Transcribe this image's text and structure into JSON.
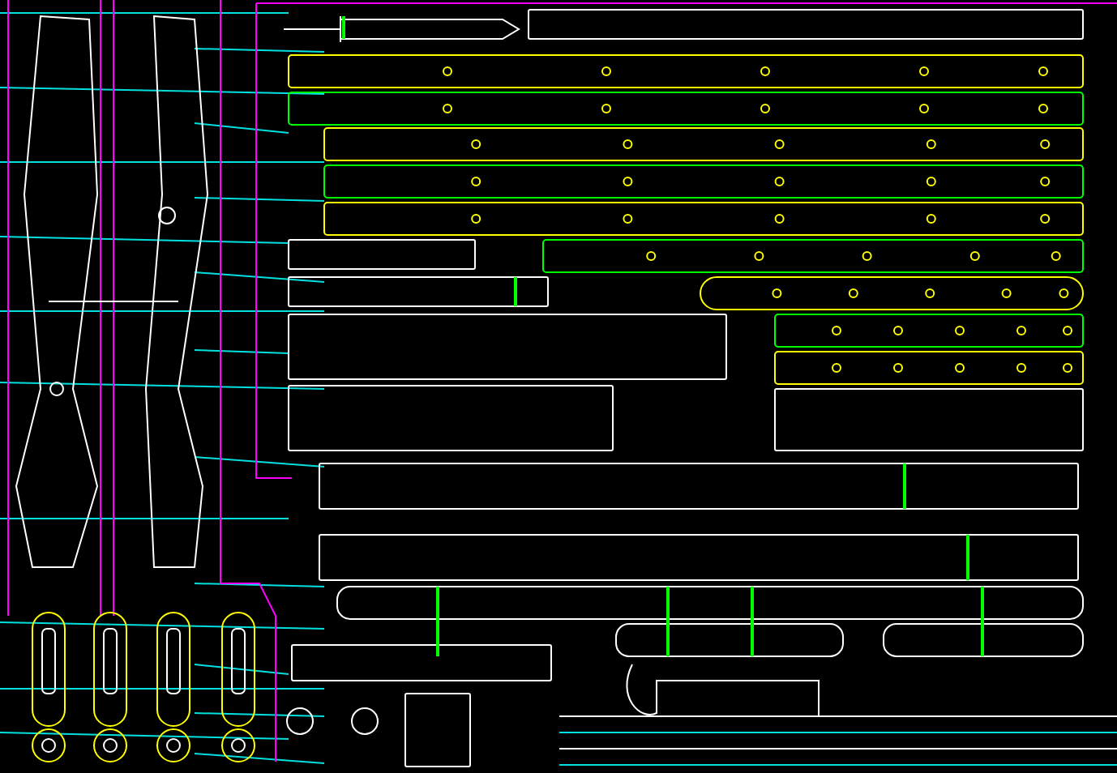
{
  "drawing": {
    "kind": "cad"
  }
}
